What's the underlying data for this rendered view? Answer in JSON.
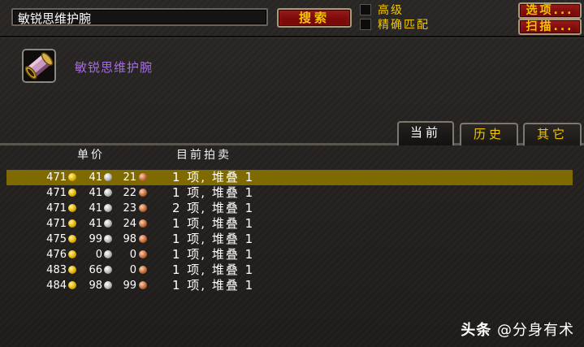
{
  "search": {
    "value": "敏锐思维护腕",
    "button_label": "搜索"
  },
  "filters": [
    {
      "label": "高级",
      "checked": false
    },
    {
      "label": "精确匹配",
      "checked": false
    }
  ],
  "buttons": {
    "options": "选项...",
    "scan": "扫描..."
  },
  "item": {
    "name": "敏锐思维护腕",
    "name_color": "#a66ee0",
    "icon": "bracer-icon"
  },
  "tabs": [
    {
      "label": "当前",
      "active": true
    },
    {
      "label": "历史",
      "active": false
    },
    {
      "label": "其它",
      "active": false
    }
  ],
  "columns": {
    "unit_price": "单价",
    "current_auctions": "目前拍卖"
  },
  "rows": [
    {
      "gold": "471",
      "silver": "41",
      "copper": "21",
      "qty": "1 项, 堆叠 1",
      "selected": true
    },
    {
      "gold": "471",
      "silver": "41",
      "copper": "22",
      "qty": "1 项, 堆叠 1",
      "selected": false
    },
    {
      "gold": "471",
      "silver": "41",
      "copper": "23",
      "qty": "2 项, 堆叠 1",
      "selected": false
    },
    {
      "gold": "471",
      "silver": "41",
      "copper": "24",
      "qty": "1 项, 堆叠 1",
      "selected": false
    },
    {
      "gold": "475",
      "silver": "99",
      "copper": "98",
      "qty": "1 项, 堆叠 1",
      "selected": false
    },
    {
      "gold": "476",
      "silver": "0",
      "copper": "0",
      "qty": "1 项, 堆叠 1",
      "selected": false
    },
    {
      "gold": "483",
      "silver": "66",
      "copper": "0",
      "qty": "1 项, 堆叠 1",
      "selected": false
    },
    {
      "gold": "484",
      "silver": "98",
      "copper": "99",
      "qty": "1 项, 堆叠 1",
      "selected": false
    }
  ],
  "watermark": {
    "brand": "头条",
    "handle": "@分身有术"
  },
  "colors": {
    "gold_text": "#f2c600",
    "button_red": "#7a0a0a",
    "selected_row": "#7e6a00"
  }
}
